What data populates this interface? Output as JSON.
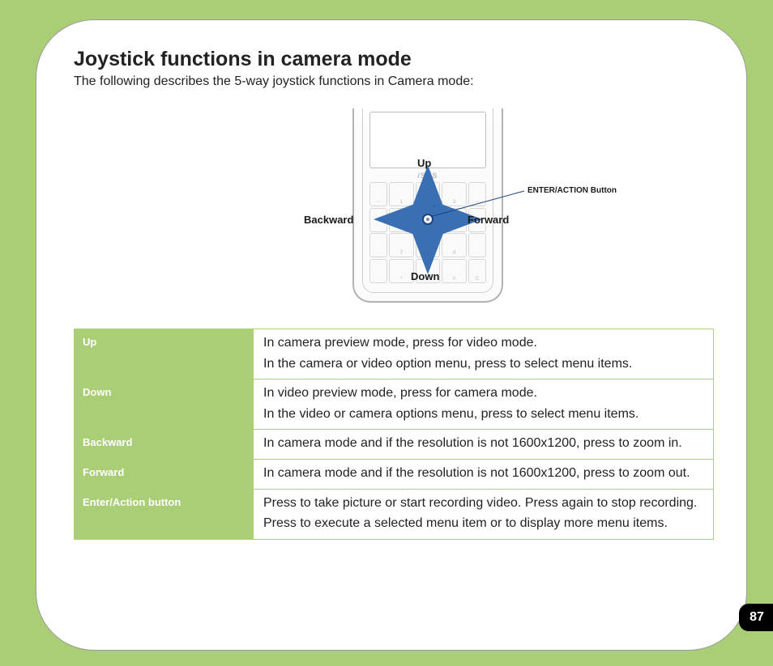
{
  "title": "Joystick functions in camera mode",
  "intro": "The following describes the 5-way joystick functions in Camera mode:",
  "diagram": {
    "up": "Up",
    "down": "Down",
    "backward": "Backward",
    "forward": "Forward",
    "enter_label": "ENTER/ACTION Button",
    "brand": "/SUS"
  },
  "table": {
    "rows": [
      {
        "label": "Up",
        "paras": [
          "In camera preview mode, press for video mode.",
          "In the camera or video option menu, press to select menu items."
        ]
      },
      {
        "label": "Down",
        "paras": [
          "In video preview mode, press for camera mode.",
          "In the video or camera options menu, press to select menu items."
        ]
      },
      {
        "label": "Backward",
        "paras": [
          "In camera mode and if the resolution is not 1600x1200, press to zoom in."
        ]
      },
      {
        "label": "Forward",
        "paras": [
          "In camera mode and if the resolution is not 1600x1200, press to zoom out."
        ]
      },
      {
        "label": "Enter/Action button",
        "paras": [
          "Press to take picture or start recording video. Press again to stop recording.",
          "Press to execute a selected menu item or to display more menu items."
        ]
      }
    ]
  },
  "page_number": "87",
  "colors": {
    "accent": "#a9ce75",
    "arrow": "#3b6fb3"
  }
}
